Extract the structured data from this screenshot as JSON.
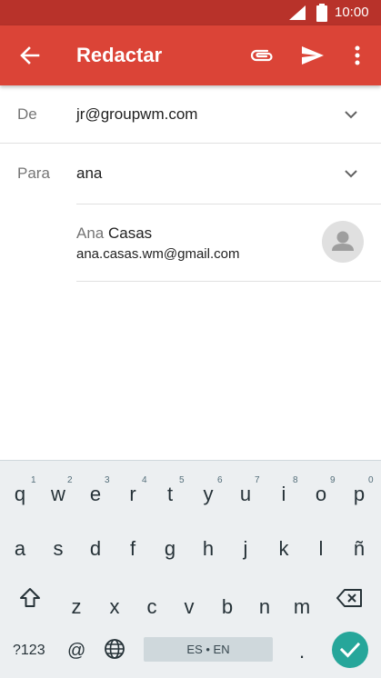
{
  "status_bar": {
    "time": "10:00",
    "signal_icon": "signal-icon",
    "battery_icon": "battery-icon"
  },
  "app_bar": {
    "title": "Redactar",
    "back_icon": "arrow-back-icon",
    "attach_icon": "paperclip-icon",
    "send_icon": "send-icon",
    "more_icon": "more-vert-icon",
    "color": "#db4437",
    "status_color": "#b8322a"
  },
  "from": {
    "label": "De",
    "value": "jr@groupwm.com"
  },
  "to": {
    "label": "Para",
    "value": "ana"
  },
  "suggestion": {
    "name_typed": "Ana",
    "name_rest": " Casas",
    "email": "ana.casas.wm@gmail.com",
    "avatar_icon": "person-icon"
  },
  "keyboard": {
    "row1": [
      {
        "key": "q",
        "hint": "1"
      },
      {
        "key": "w",
        "hint": "2"
      },
      {
        "key": "e",
        "hint": "3"
      },
      {
        "key": "r",
        "hint": "4"
      },
      {
        "key": "t",
        "hint": "5"
      },
      {
        "key": "y",
        "hint": "6"
      },
      {
        "key": "u",
        "hint": "7"
      },
      {
        "key": "i",
        "hint": "8"
      },
      {
        "key": "o",
        "hint": "9"
      },
      {
        "key": "p",
        "hint": "0"
      }
    ],
    "row2": [
      "a",
      "s",
      "d",
      "f",
      "g",
      "h",
      "j",
      "k",
      "l",
      "ñ"
    ],
    "row3": [
      "z",
      "x",
      "c",
      "v",
      "b",
      "n",
      "m"
    ],
    "symbols_label": "?123",
    "at_label": "@",
    "space_label": "ES • EN",
    "period_label": ".",
    "shift_icon": "shift-icon",
    "backspace_icon": "backspace-icon",
    "globe_icon": "globe-icon",
    "enter_icon": "check-icon",
    "enter_color": "#26a69a"
  }
}
